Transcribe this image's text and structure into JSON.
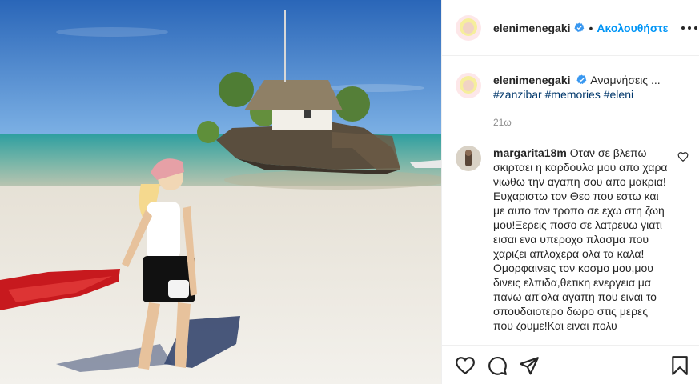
{
  "post": {
    "author": {
      "username": "elenimenegaki",
      "verified": true
    },
    "follow_label": "Ακολουθήστε",
    "separator": "•",
    "caption": {
      "text": "Αναμνήσεις ...",
      "hashtags": "#zanzibar #memories #eleni"
    },
    "time_ago": "21ω"
  },
  "comments": [
    {
      "username": "margarita18m",
      "text": "Οταν σε βλεπω σκιρταει η καρδουλα μου απο χαρα νιωθω την αγαπη σου απο μακρια!Ευχαριστω τον Θεο που εστω και με αυτο τον τροπο σε εχω στη ζωη μου!Ξερεις ποσο σε λατρευω γιατι εισαι ενα υπεροχο πλασμα που χαριζει απλοχερα ολα τα καλα!Ομορφαινεις τον κοσμο μου,μου δινεις ελπιδα,θετικη ενεργεια μα πανω απ'ολα αγαπη που ειναι το σπουδαιοτερο δωρο στις μερες που ζουμε!Και ειναι πολυ"
    }
  ],
  "icons": {
    "more": "more-options-icon",
    "verified": "verified-badge-icon",
    "like": "heart-icon",
    "comment": "comment-icon",
    "share": "share-icon",
    "save": "bookmark-icon"
  },
  "colors": {
    "link_blue": "#0095f6",
    "hashtag": "#00376b",
    "muted": "#8e8e8e",
    "text": "#262626"
  }
}
